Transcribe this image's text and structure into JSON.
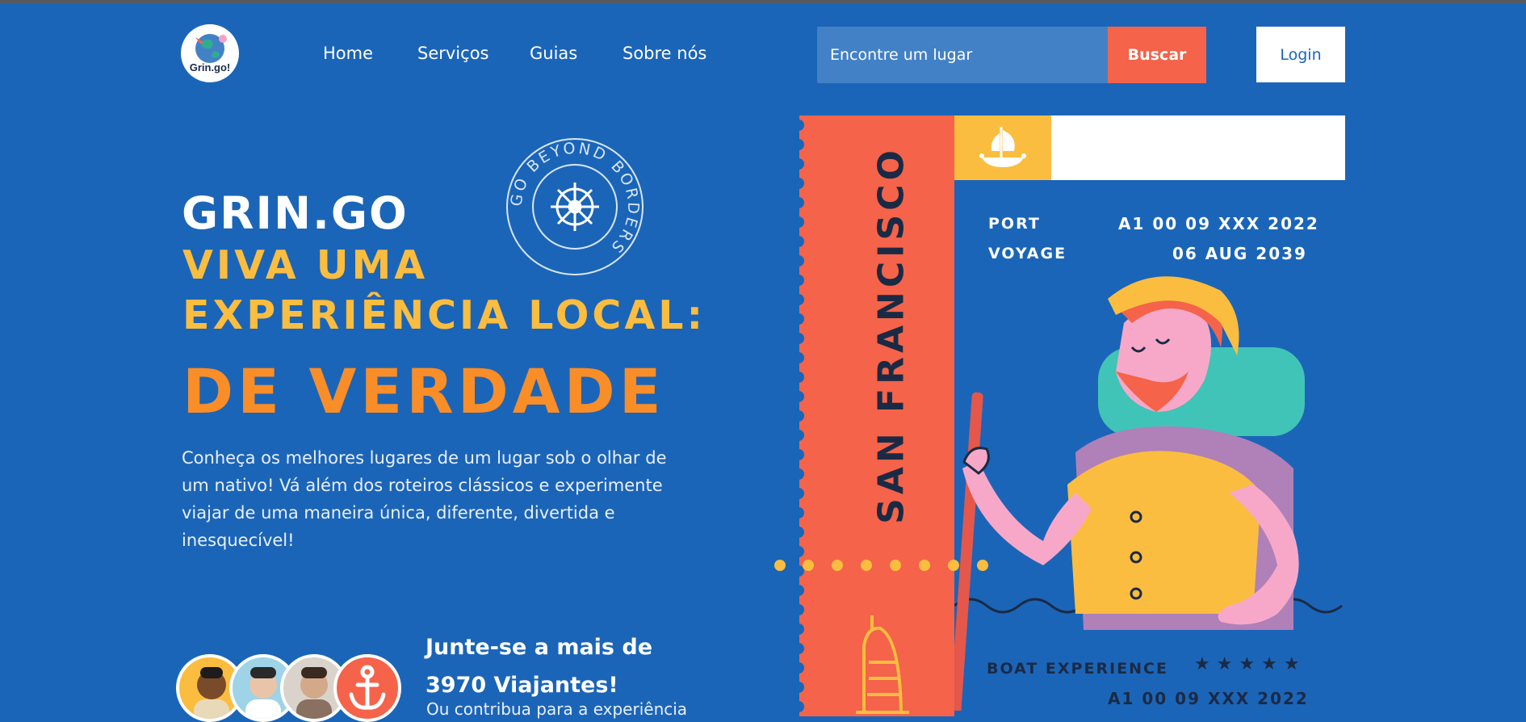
{
  "brand": {
    "logo_text": "Grin.go!"
  },
  "nav": {
    "links": [
      "Home",
      "Serviços",
      "Guias",
      "Sobre nós"
    ],
    "search_placeholder": "Encontre um lugar",
    "search_button": "Buscar",
    "login_button": "Login"
  },
  "hero": {
    "brand": "GRIN.GO",
    "line1": "VIVA UMA",
    "line2": "EXPERIÊNCIA LOCAL:",
    "line3": "DE VERDADE",
    "description": "Conheça os melhores lugares de um lugar sob o olhar de um nativo! Vá além dos roteiros clássicos e experimente viajar de uma maneira única, diferente, divertida e inesquecível!",
    "stamp_text": "GO BEYOND BORDERS"
  },
  "join": {
    "title": "Junte-se a mais de 3970 Viajantes!",
    "subtitle": "Ou contribua para a experiência"
  },
  "ticket": {
    "city": "SAN FRANCISCO",
    "port_label": "PORT",
    "port_value": "A1 00 09 XXX 2022",
    "voyage_label": "VOYAGE",
    "voyage_value": "06 AUG 2039",
    "experience_label": "BOAT EXPERIENCE",
    "rating_stars": "★★★★★",
    "bottom_code": "A1 00 09 XXX 2022"
  },
  "colors": {
    "background": "#1b65b8",
    "accent_coral": "#f4634a",
    "accent_yellow": "#fbbd3f",
    "accent_orange": "#f98d27"
  }
}
